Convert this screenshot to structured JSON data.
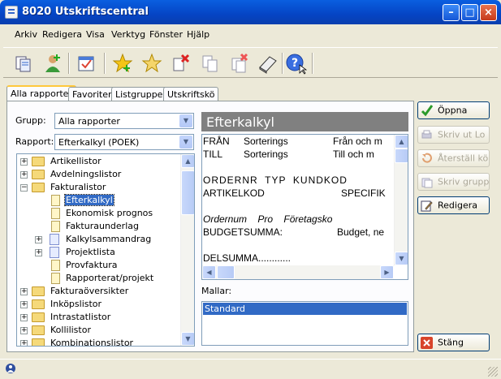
{
  "window": {
    "title": "8020 Utskriftscentral"
  },
  "menu": [
    "Arkiv",
    "Redigera",
    "Visa",
    "Verktyg",
    "Fönster",
    "Hjälp"
  ],
  "toolbar_icons": [
    "report-icon",
    "add-user-icon",
    "calendar-check-icon",
    "new-star-icon",
    "star-icon",
    "delete-icon",
    "copy-icon",
    "delete-copy-icon",
    "book-icon",
    "help-icon"
  ],
  "tabs": [
    "Alla rapporter",
    "Favoriter",
    "Listgrupper",
    "Utskriftskö"
  ],
  "form": {
    "group_label": "Grupp:",
    "group_value": "Alla rapporter",
    "report_label": "Rapport:",
    "report_value": "Efterkalkyl (POEK)"
  },
  "tree": [
    {
      "label": "Artikellistor",
      "level": 0,
      "type": "folder",
      "expander": "+"
    },
    {
      "label": "Avdelningslistor",
      "level": 0,
      "type": "folder",
      "expander": "+"
    },
    {
      "label": "Fakturalistor",
      "level": 0,
      "type": "folder-open",
      "expander": "-"
    },
    {
      "label": "Efterkalkyl",
      "level": 1,
      "type": "doc",
      "selected": true
    },
    {
      "label": "Ekonomisk prognos",
      "level": 1,
      "type": "doc"
    },
    {
      "label": "Fakturaunderlag",
      "level": 1,
      "type": "doc"
    },
    {
      "label": "Kalkylsammandrag",
      "level": 1,
      "type": "doc2",
      "expander": "+"
    },
    {
      "label": "Projektlista",
      "level": 1,
      "type": "doc2",
      "expander": "+"
    },
    {
      "label": "Provfaktura",
      "level": 1,
      "type": "doc"
    },
    {
      "label": "Rapporterat/projekt",
      "level": 1,
      "type": "doc"
    },
    {
      "label": "Fakturaöversikter",
      "level": 0,
      "type": "folder",
      "expander": "+"
    },
    {
      "label": "Inköpslistor",
      "level": 0,
      "type": "folder",
      "expander": "+"
    },
    {
      "label": "Intrastatlistor",
      "level": 0,
      "type": "folder",
      "expander": "+"
    },
    {
      "label": "Kollilistor",
      "level": 0,
      "type": "folder",
      "expander": "+"
    },
    {
      "label": "Kombinationslistor",
      "level": 0,
      "type": "folder",
      "expander": "+"
    }
  ],
  "preview": {
    "title": "Efterkalkyl",
    "lines": [
      {
        "segments": [
          "FRÅN",
          "Sorterings",
          "Från och m"
        ]
      },
      {
        "segments": [
          "TILL",
          "Sorterings",
          "Till och m"
        ]
      },
      {
        "segments": [
          "ORDERNR  TYP  KUNDKOD"
        ]
      },
      {
        "segments": [
          "ARTIKELKOD",
          "SPECIFIK"
        ]
      },
      {
        "segments": [
          "Ordernum    Pro    Företagsko"
        ]
      },
      {
        "segments": [
          "BUDGETSUMMA:",
          "Budget, ne"
        ]
      },
      {
        "segments": [
          "DELSUMMA............"
        ]
      }
    ]
  },
  "templates": {
    "label": "Mallar:",
    "items": [
      "Standard"
    ]
  },
  "buttons": [
    {
      "label": "Öppna",
      "enabled": true,
      "icon": "check-icon"
    },
    {
      "label": "Skriv ut Lo",
      "enabled": false,
      "icon": "print-icon"
    },
    {
      "label": "Återställ kö",
      "enabled": false,
      "icon": "reset-icon"
    },
    {
      "label": "Skriv grupp",
      "enabled": false,
      "icon": "print-group-icon"
    },
    {
      "label": "Redigera",
      "enabled": true,
      "icon": "edit-icon"
    },
    {
      "label": "Stäng",
      "enabled": true,
      "icon": "close-icon"
    }
  ],
  "colors": {
    "titlebar": "#0a5fe0",
    "selection": "#316ac5",
    "preview_header": "#808080"
  }
}
